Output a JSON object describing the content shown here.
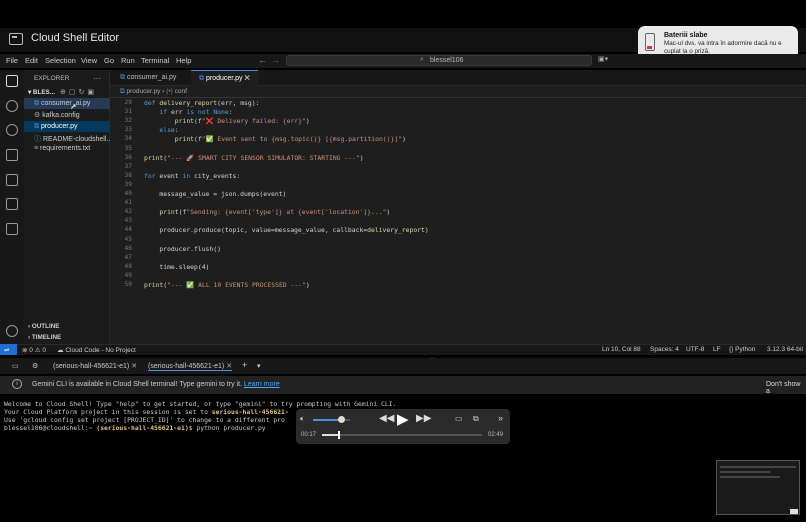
{
  "app": {
    "title": "Cloud Shell Editor"
  },
  "notification": {
    "title": "Bateriii slabe",
    "body": "Mac-ul dvs. va intra în adormire dacă nu e cuplat la o priză."
  },
  "menu": [
    "File",
    "Edit",
    "Selection",
    "View",
    "Go",
    "Run",
    "Terminal",
    "Help"
  ],
  "search": {
    "text": "blessel106"
  },
  "explorer": {
    "title": "EXPLORER",
    "root": "BLES...",
    "files": [
      "consumer_ai.py",
      "kafka.config",
      "producer.py",
      "README-cloudshell...",
      "requirements.txt"
    ],
    "outline": "OUTLINE",
    "timeline": "TIMELINE"
  },
  "tabs": [
    "consumer_ai.py",
    "producer.py"
  ],
  "breadcrumb": {
    "file": "producer.py",
    "symbol": "conf"
  },
  "code": {
    "line_numbers": [
      "29",
      "31",
      "32",
      "33",
      "34",
      "35",
      "36",
      "37",
      "38",
      "39",
      "40",
      "41",
      "42",
      "43",
      "44",
      "45",
      "46",
      "47",
      "48",
      "49",
      "50"
    ],
    "lines": [
      "def delivery_report(err, msg):",
      "    if err is not None:",
      "        print(f\"❌ Delivery failed: {err}\")",
      "    else:",
      "        print(f\"✅ Event sent to {msg.topic()} [{msg.partition()}]\")",
      "",
      "print(\"--- 🚀 SMART CITY SENSOR SIMULATOR: STARTING ---\")",
      "",
      "for event in city_events:",
      "",
      "    message_value = json.dumps(event)",
      "",
      "    print(f\"Sending: {event['type']} at {event['location']}...\")",
      "",
      "    producer.produce(topic, value=message_value, callback=delivery_report)",
      "",
      "    producer.flush()",
      "",
      "    time.sleep(4)",
      "",
      "print(\"--- ✅ ALL 10 EVENTS PROCESSED ---\")"
    ]
  },
  "status": {
    "errors": "0",
    "warnings": "0",
    "cloud_code": "Cloud Code - No Project",
    "position": "Ln 10, Col 88",
    "spaces": "Spaces: 4",
    "encoding": "UTF-8",
    "eol": "LF",
    "language": "Python",
    "version": "3.12.3 64-bit"
  },
  "terminal": {
    "tabs": [
      "(serious-hall-456621-e1)",
      "(serious-hall-456621-e1)"
    ],
    "info": "Gemini CLI is available in Cloud Shell terminal! Type gemini to try it.",
    "info_link": "Learn more",
    "info_dismiss": "Don't show a",
    "line1": "Welcome to Cloud Shell! Type \"help\" to get started, or type \"gemini\" to try prompting with Gemini CLI.",
    "line2_a": "Your Cloud Platform project in this session is set to ",
    "line2_b": "serious-hall-456621-",
    "line3": "Use 'gcloud config set project [PROJECT_ID]' to change to a different pro",
    "prompt_user": "blessel106@cloudshell:~ ",
    "prompt_project": "(serious-hall-456621-e1)",
    "prompt_cmd": "$ python producer.py"
  },
  "player": {
    "elapsed": "00:17",
    "duration": "02:49",
    "progress": 0.1,
    "volume": 0.75
  }
}
